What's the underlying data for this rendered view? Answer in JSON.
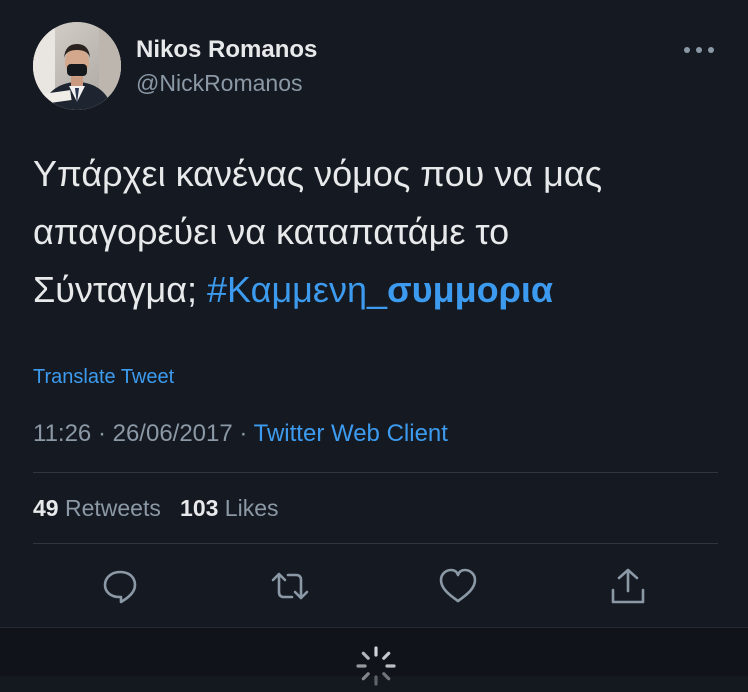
{
  "user": {
    "name": "Nikos Romanos",
    "handle": "@NickRomanos"
  },
  "tweet": {
    "text_line1": "Υπάρχει κανένας νόμος που να μας",
    "text_line2": "απαγορεύει να καταπατάμε το",
    "text_line3_prefix": "Σύνταγμα; ",
    "hashtag_part1": "#Καμμενη_",
    "hashtag_part2": "συμμορια",
    "translate_label": "Translate Tweet",
    "time": "11:26",
    "separator1": " · ",
    "date": "26/06/2017",
    "separator2": " · ",
    "client": "Twitter Web Client"
  },
  "stats": {
    "retweets_count": "49",
    "retweets_label": "Retweets",
    "likes_count": "103",
    "likes_label": "Likes"
  },
  "icons": {
    "more": "more-horizontal-icon",
    "reply": "reply-icon",
    "retweet": "retweet-icon",
    "like": "heart-icon",
    "share": "share-icon",
    "loading": "loading-spinner-icon"
  },
  "colors": {
    "background": "#151a22",
    "text": "#e7e9ea",
    "secondary": "#8b98a5",
    "accent": "#3d9bef"
  }
}
